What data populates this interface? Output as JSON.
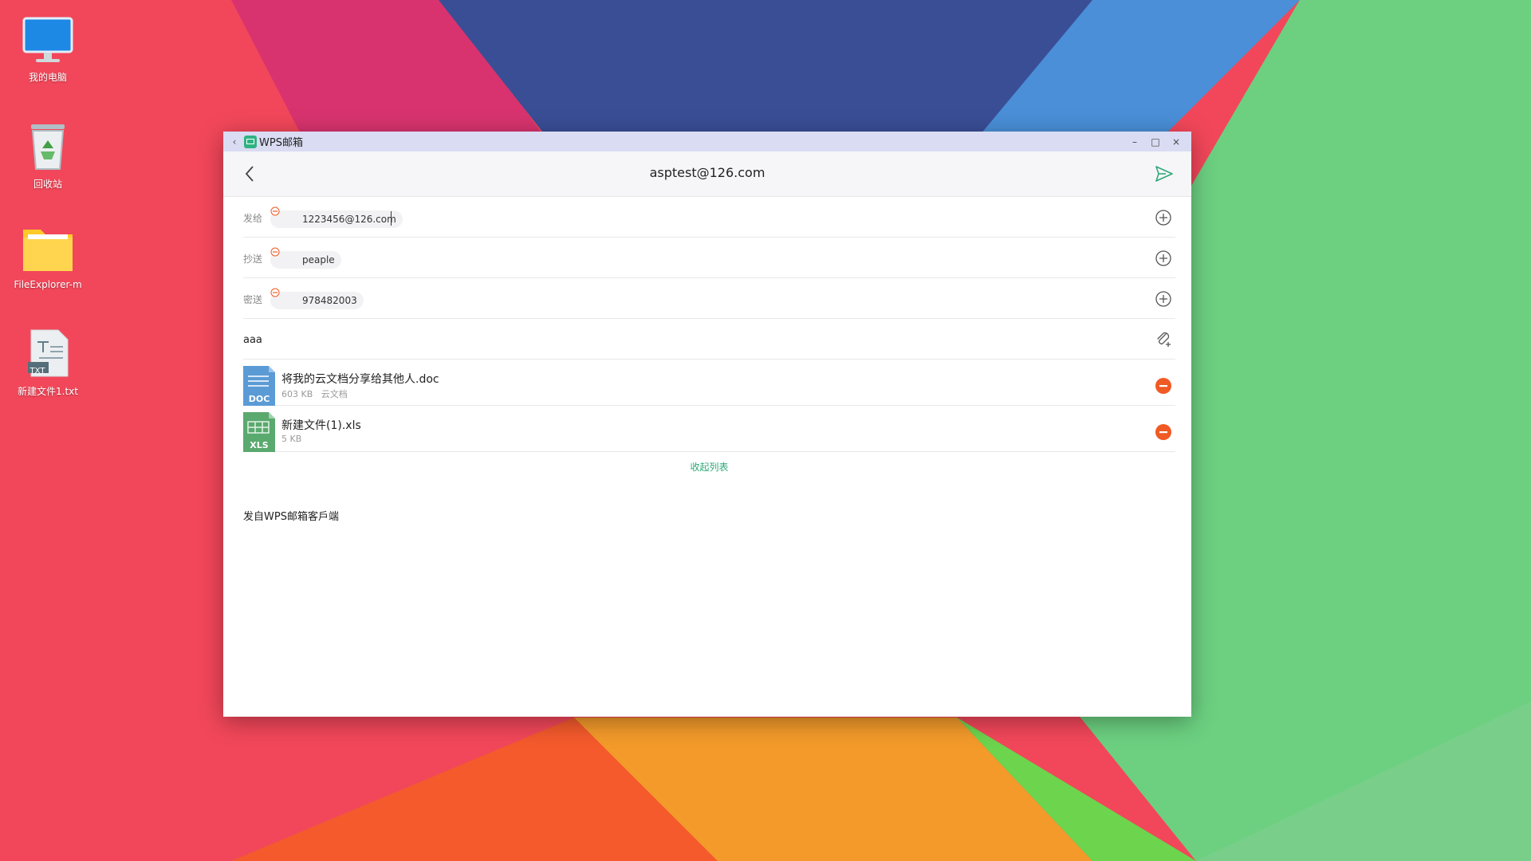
{
  "desktop": {
    "icons": [
      {
        "label": "我的电脑",
        "icon": "computer-icon"
      },
      {
        "label": "回收站",
        "icon": "recycle-bin-icon"
      },
      {
        "label": "FileExplorer-m",
        "icon": "folder-icon"
      },
      {
        "label": "新建文件1.txt",
        "icon": "txt-file-icon",
        "badge": "TXT"
      }
    ]
  },
  "window": {
    "app_title": "WPS邮箱",
    "controls": {
      "back": "‹",
      "minimize": "–",
      "maximize": "□",
      "close": "×"
    }
  },
  "compose": {
    "header_title": "asptest@126.com",
    "to": {
      "label": "发给",
      "chip": "1223456@126.com"
    },
    "cc": {
      "label": "抄送",
      "chip": "peaple"
    },
    "bcc": {
      "label": "密送",
      "chip": "978482003"
    },
    "subject": "aaa",
    "attachments": [
      {
        "name": "将我的云文档分享给其他人.doc",
        "size": "603 KB",
        "source": "云文档",
        "type": "DOC",
        "color": "#5b9bd5"
      },
      {
        "name": "新建文件(1).xls",
        "size": "5 KB",
        "source": "",
        "type": "XLS",
        "color": "#5aa96e"
      }
    ],
    "collapse_label": "收起列表",
    "signature": "发自WPS邮箱客戶端"
  },
  "colors": {
    "accent": "#2fa878",
    "remove": "#f05a24",
    "titlebar": "#d9dcf2"
  }
}
